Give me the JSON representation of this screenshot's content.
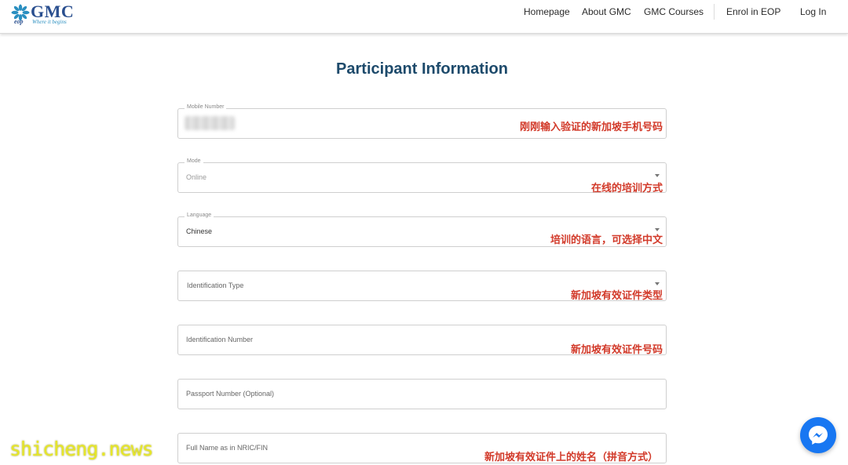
{
  "header": {
    "logo_text": "GMC",
    "logo_sub": "eop",
    "logo_tagline": "Where it begins",
    "nav": [
      "Homepage",
      "About GMC",
      "GMC Courses",
      "Enrol in EOP",
      "Log In"
    ]
  },
  "page_title": "Participant Information",
  "fields": [
    {
      "label": "Mobile Number",
      "annotation": "刚刚输入验证的新加坡手机号码"
    },
    {
      "label": "Mode",
      "value": "Online",
      "annotation": "在线的培训方式"
    },
    {
      "label": "Language",
      "value": "Chinese",
      "annotation": "培训的语言，可选择中文"
    },
    {
      "placeholder": "Identification Type",
      "annotation": "新加坡有效证件类型"
    },
    {
      "placeholder": "Identification Number",
      "annotation": "新加坡有效证件号码"
    },
    {
      "placeholder": "Passport Number (Optional)"
    },
    {
      "placeholder": "Full Name as in NRIC/FIN",
      "annotation": "新加坡有效证件上的姓名（拼音方式）"
    }
  ],
  "watermark": "shicheng.news",
  "colors": {
    "brand": "#2a4f8f",
    "title": "#1d4a6b",
    "annotation": "#d23a2a",
    "messenger": "#1877f2"
  },
  "icons": {
    "logo": "flower-logo-icon",
    "chat": "messenger-icon"
  }
}
